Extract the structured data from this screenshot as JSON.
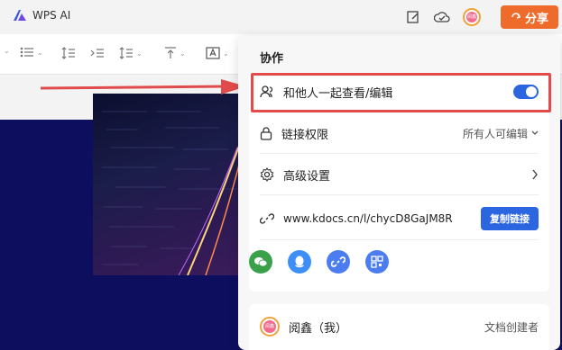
{
  "app": {
    "title": "WPS AI"
  },
  "topbar": {
    "share_label": "分享",
    "avatar_text": "阅鑫",
    "icons": [
      "edit-icon",
      "cloud-check-icon"
    ]
  },
  "toolbar": {
    "items": [
      "list",
      "line-spacing",
      "indent",
      "para-spacing",
      "align-top",
      "text-box"
    ]
  },
  "panel": {
    "title": "协作",
    "collab_label": "和他人一起查看/编辑",
    "collab_enabled": true,
    "permission_label": "链接权限",
    "permission_value": "所有人可编辑",
    "advanced_label": "高级设置",
    "link_text": "www.kdocs.cn/l/chycD8GaJM8R",
    "copy_label": "复制链接",
    "share_targets": [
      "wechat-icon",
      "qq-icon",
      "link-icon",
      "qrcode-icon"
    ]
  },
  "user": {
    "name": "阅鑫（我）",
    "role": "文档创建者",
    "avatar_text": "阅鑫"
  },
  "colors": {
    "accent": "#2b66e0",
    "share": "#ee6b2c",
    "highlight": "#e24b4b",
    "doc_bg": "#0d0f5e"
  }
}
